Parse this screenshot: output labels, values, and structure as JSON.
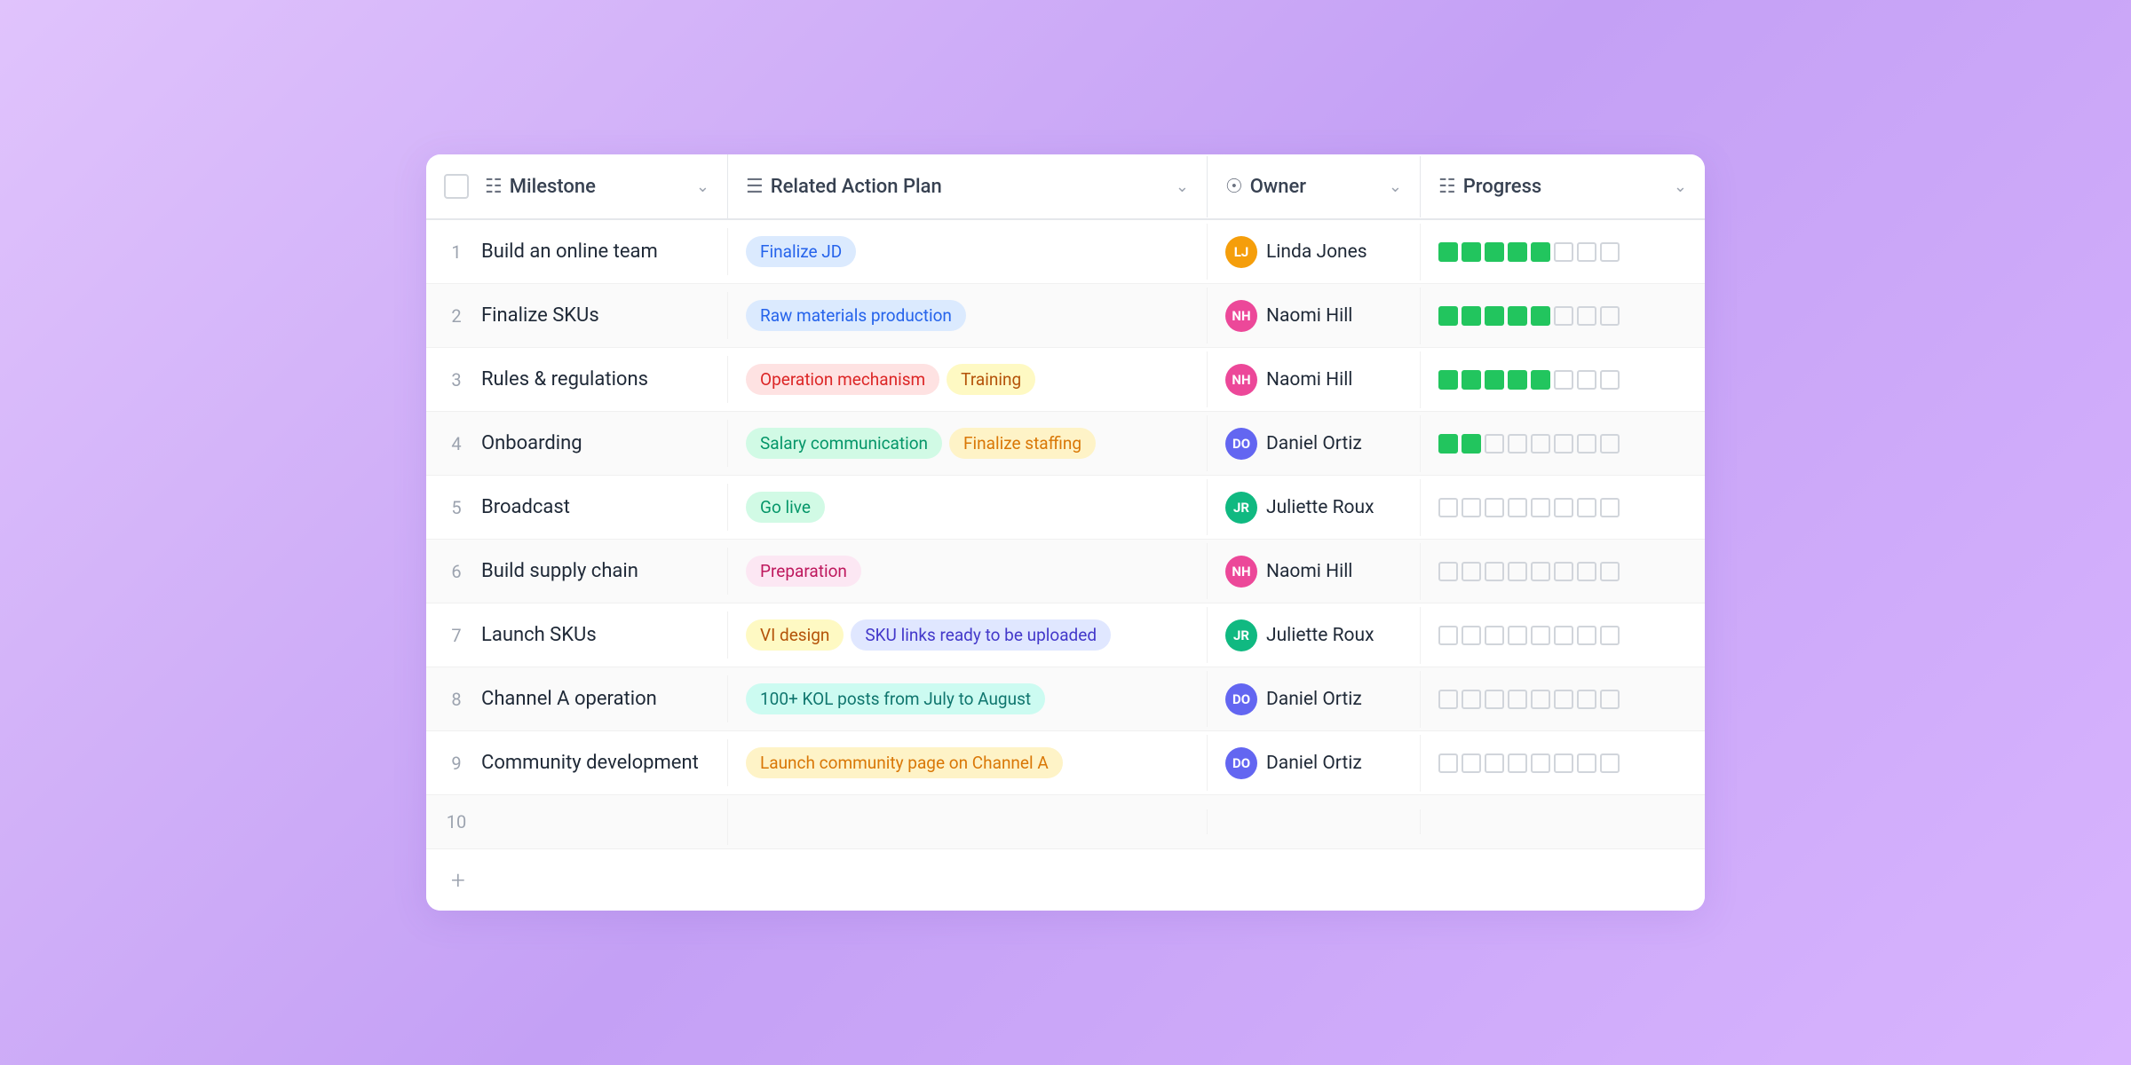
{
  "header": {
    "checkbox_label": "",
    "milestone_label": "Milestone",
    "action_plan_label": "Related Action Plan",
    "owner_label": "Owner",
    "progress_label": "Progress"
  },
  "rows": [
    {
      "num": "1",
      "milestone": "Build an online team",
      "tags": [
        {
          "label": "Finalize JD",
          "style": "blue"
        }
      ],
      "owner": "Linda Jones",
      "owner_style": "linda",
      "owner_initials": "LJ",
      "progress_filled": 5,
      "progress_total": 8
    },
    {
      "num": "2",
      "milestone": "Finalize SKUs",
      "tags": [
        {
          "label": "Raw materials production",
          "style": "blue"
        }
      ],
      "owner": "Naomi Hill",
      "owner_style": "naomi",
      "owner_initials": "NH",
      "progress_filled": 5,
      "progress_total": 8
    },
    {
      "num": "3",
      "milestone": "Rules & regulations",
      "tags": [
        {
          "label": "Operation mechanism",
          "style": "orange"
        },
        {
          "label": "Training",
          "style": "yellow"
        }
      ],
      "owner": "Naomi Hill",
      "owner_style": "naomi",
      "owner_initials": "NH",
      "progress_filled": 5,
      "progress_total": 8
    },
    {
      "num": "4",
      "milestone": "Onboarding",
      "tags": [
        {
          "label": "Salary communication",
          "style": "green"
        },
        {
          "label": "Finalize staffing",
          "style": "peach"
        }
      ],
      "owner": "Daniel Ortiz",
      "owner_style": "daniel",
      "owner_initials": "DO",
      "progress_filled": 2,
      "progress_total": 8
    },
    {
      "num": "5",
      "milestone": "Broadcast",
      "tags": [
        {
          "label": "Go live",
          "style": "green"
        }
      ],
      "owner": "Juliette Roux",
      "owner_style": "juliette",
      "owner_initials": "JR",
      "progress_filled": 0,
      "progress_total": 8
    },
    {
      "num": "6",
      "milestone": "Build supply chain",
      "tags": [
        {
          "label": "Preparation",
          "style": "pink"
        }
      ],
      "owner": "Naomi Hill",
      "owner_style": "naomi",
      "owner_initials": "NH",
      "progress_filled": 0,
      "progress_total": 8
    },
    {
      "num": "7",
      "milestone": "Launch SKUs",
      "tags": [
        {
          "label": "VI design",
          "style": "yellow"
        },
        {
          "label": "SKU links ready to be uploaded",
          "style": "indigo"
        }
      ],
      "owner": "Juliette Roux",
      "owner_style": "juliette",
      "owner_initials": "JR",
      "progress_filled": 0,
      "progress_total": 8
    },
    {
      "num": "8",
      "milestone": "Channel A operation",
      "tags": [
        {
          "label": "100+ KOL posts from July to August",
          "style": "teal"
        }
      ],
      "owner": "Daniel Ortiz",
      "owner_style": "daniel",
      "owner_initials": "DO",
      "progress_filled": 0,
      "progress_total": 8
    },
    {
      "num": "9",
      "milestone": "Community development",
      "tags": [
        {
          "label": "Launch community page on Channel A",
          "style": "peach"
        }
      ],
      "owner": "Daniel Ortiz",
      "owner_style": "daniel",
      "owner_initials": "DO",
      "progress_filled": 0,
      "progress_total": 8
    },
    {
      "num": "10",
      "milestone": "",
      "tags": [],
      "owner": "",
      "owner_style": "",
      "owner_initials": "",
      "progress_filled": 0,
      "progress_total": 0
    }
  ],
  "add_row_label": "+"
}
